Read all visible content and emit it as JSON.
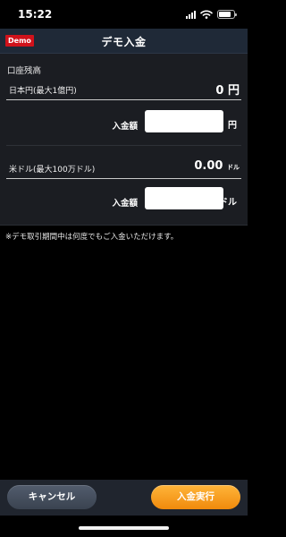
{
  "status_bar": {
    "time": "15:22"
  },
  "header": {
    "badge": "Demo",
    "title": "デモ入金"
  },
  "account": {
    "section_label": "口座残高",
    "jpy": {
      "label": "日本円(最大1億円)",
      "balance": "0",
      "unit": "円",
      "input_label": "入金額",
      "input_value": "",
      "input_unit": "円"
    },
    "usd": {
      "label": "米ドル(最大100万ドル)",
      "balance": "0.00",
      "unit": "ドル",
      "input_label": "入金額",
      "input_value": "",
      "input_unit": "ドル"
    }
  },
  "note": "※デモ取引期間中は何度でもご入金いただけます。",
  "footer": {
    "cancel_label": "キャンセル",
    "execute_label": "入金実行"
  },
  "colors": {
    "execute_button": "#f39c1f",
    "demo_badge": "#d0121b"
  },
  "icons": [
    "cellular-signal-icon",
    "wifi-icon",
    "battery-icon"
  ]
}
